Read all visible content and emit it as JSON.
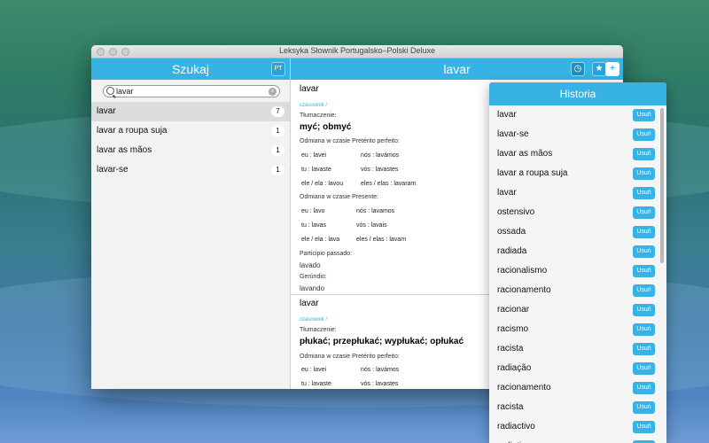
{
  "window": {
    "title": "Leksyka Słownik Portugalsko–Polski Deluxe"
  },
  "left": {
    "header": "Szukaj",
    "lang_button": "PT",
    "search_value": "lavar",
    "results": [
      {
        "label": "lavar",
        "count": "7"
      },
      {
        "label": "lavar a roupa suja",
        "count": "1"
      },
      {
        "label": "lavar as mãos",
        "count": "1"
      },
      {
        "label": "lavar-se",
        "count": "1"
      }
    ]
  },
  "right": {
    "header": "lavar",
    "entry1": {
      "word": "lavar",
      "pos": "czasownik /",
      "tr_label": "Tłumaczenie:",
      "translation": "myć; obmyć",
      "conj1_label": "Odmiana w czasie Pretérito perfeito:",
      "conj1": [
        [
          "eu : lavei",
          "nós : lavámos"
        ],
        [
          "tu : lavaste",
          "vós : lavastes"
        ],
        [
          "ele / ela : lavou",
          "eles / elas : lavaram"
        ]
      ],
      "conj2_label": "Odmiana w czasie Presente:",
      "conj2": [
        [
          "eu : lavo",
          "nós : lavamos"
        ],
        [
          "tu : lavas",
          "vós : lavais"
        ],
        [
          "ele / ela : lava",
          "eles / elas : lavam"
        ]
      ],
      "participle_label": "Participio passado:",
      "participle": "lavado",
      "gerund_label": "Gerúndio:",
      "gerund": "lavando"
    },
    "entry2": {
      "word": "lavar",
      "pos": "czasownik /",
      "tr_label": "Tłumaczenie:",
      "translation": "płukać; przepłukać; wypłukać; opłukać",
      "conj1_label": "Odmiana w czasie Pretérito perfeito:",
      "conj1": [
        [
          "eu : lavei",
          "nós : lavámos"
        ],
        [
          "tu : lavaste",
          "vós : lavastes"
        ]
      ]
    }
  },
  "history": {
    "title": "Historia",
    "remove_label": "Usuń",
    "items": [
      "lavar",
      "lavar-se",
      "lavar as mãos",
      "lavar a roupa suja",
      "lavar",
      "ostensivo",
      "ossada",
      "radiada",
      "racionalismo",
      "racionamento",
      "racionar",
      "racismo",
      "racista",
      "radiação",
      "racionamento",
      "racista",
      "radiactivo",
      "radiativo"
    ]
  },
  "colors": {
    "accent": "#36b2e4"
  }
}
